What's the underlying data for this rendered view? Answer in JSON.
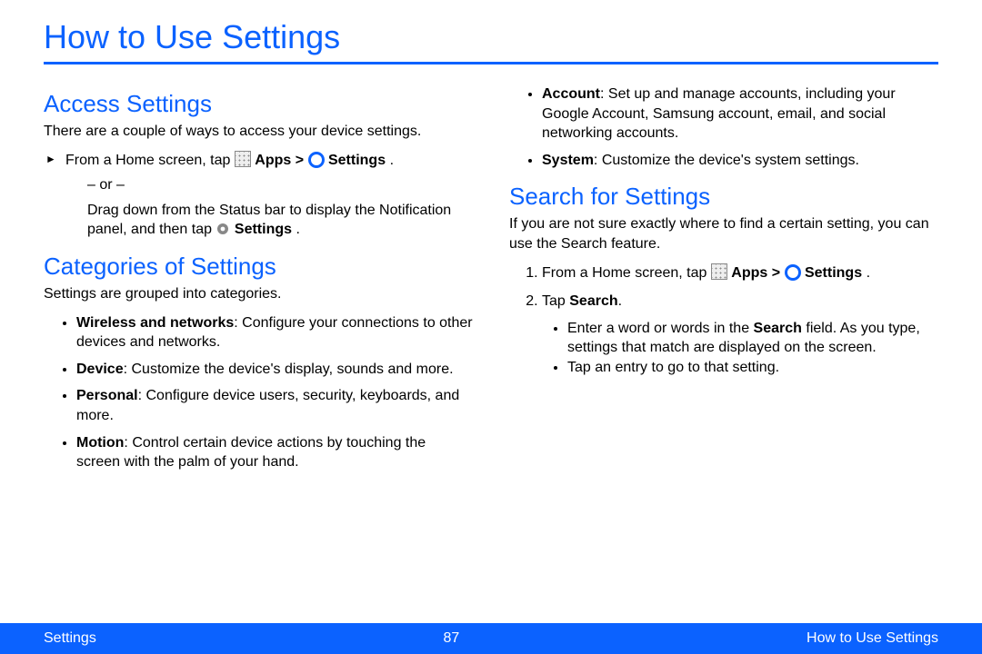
{
  "page_title": "How to Use Settings",
  "footer": {
    "left": "Settings",
    "center": "87",
    "right": "How to Use Settings"
  },
  "left": {
    "access": {
      "heading": "Access Settings",
      "intro": "There are a couple of ways to access your device settings.",
      "step_prefix": "From a Home screen, tap ",
      "apps_label": "Apps > ",
      "settings_label": "Settings",
      "period": " .",
      "or": "– or –",
      "alt_a": "Drag down from the Status bar to display the Notification panel, and then tap ",
      "alt_b": "Settings",
      "alt_c": " ."
    },
    "categories": {
      "heading": "Categories of Settings",
      "intro": "Settings are grouped into categories.",
      "items": [
        {
          "term": "Wireless and networks",
          "desc": ": Configure your connections to other devices and networks."
        },
        {
          "term": "Device",
          "desc": ": Customize the device's display, sounds and more."
        },
        {
          "term": "Personal",
          "desc": ": Configure device users, security, keyboards, and more."
        },
        {
          "term": "Motion",
          "desc": ": Control certain device actions by touching the screen with the palm of your hand."
        }
      ]
    }
  },
  "right": {
    "categories_cont": [
      {
        "term": "Account",
        "desc": ": Set up and manage accounts, including your Google Account, Samsung account, email, and social networking accounts."
      },
      {
        "term": "System",
        "desc": ": Customize the device's system settings."
      }
    ],
    "search": {
      "heading": "Search for Settings",
      "intro": "If you are not sure exactly where to find a certain setting, you can use the Search feature.",
      "step1_prefix": "From a Home screen, tap ",
      "apps_label": "Apps >  ",
      "settings_label": "Settings",
      "period": " .",
      "step2_a": "Tap ",
      "step2_b": "Search",
      "step2_c": ".",
      "sub": [
        {
          "a": "Enter a word or words in the ",
          "b": "Search",
          "c": " field. As you type, settings that match are displayed on the screen."
        },
        {
          "a": "Tap an entry to go to that setting.",
          "b": "",
          "c": ""
        }
      ]
    }
  }
}
